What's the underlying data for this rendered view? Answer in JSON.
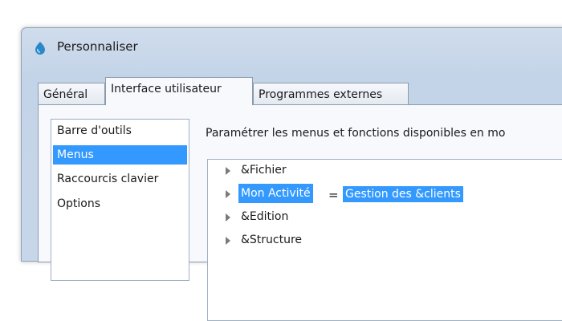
{
  "window": {
    "title": "Personnaliser",
    "icon": "app-icon"
  },
  "tabs": [
    {
      "label": "Général"
    },
    {
      "label": "Interface utilisateur",
      "active": true
    },
    {
      "label": "Programmes externes"
    }
  ],
  "sidebar": {
    "items": [
      {
        "label": "Barre d'outils"
      },
      {
        "label": "Menus",
        "selected": true
      },
      {
        "label": "Raccourcis clavier"
      },
      {
        "label": "Options"
      }
    ]
  },
  "main": {
    "description": "Paramétrer les menus et fonctions disponibles en mo",
    "tree": [
      {
        "label": "&Fichier"
      },
      {
        "label": "Mon Activité",
        "selected": true,
        "alias": "Gestion des &clients"
      },
      {
        "label": "&Edition"
      },
      {
        "label": "&Structure"
      }
    ],
    "separator": "="
  }
}
